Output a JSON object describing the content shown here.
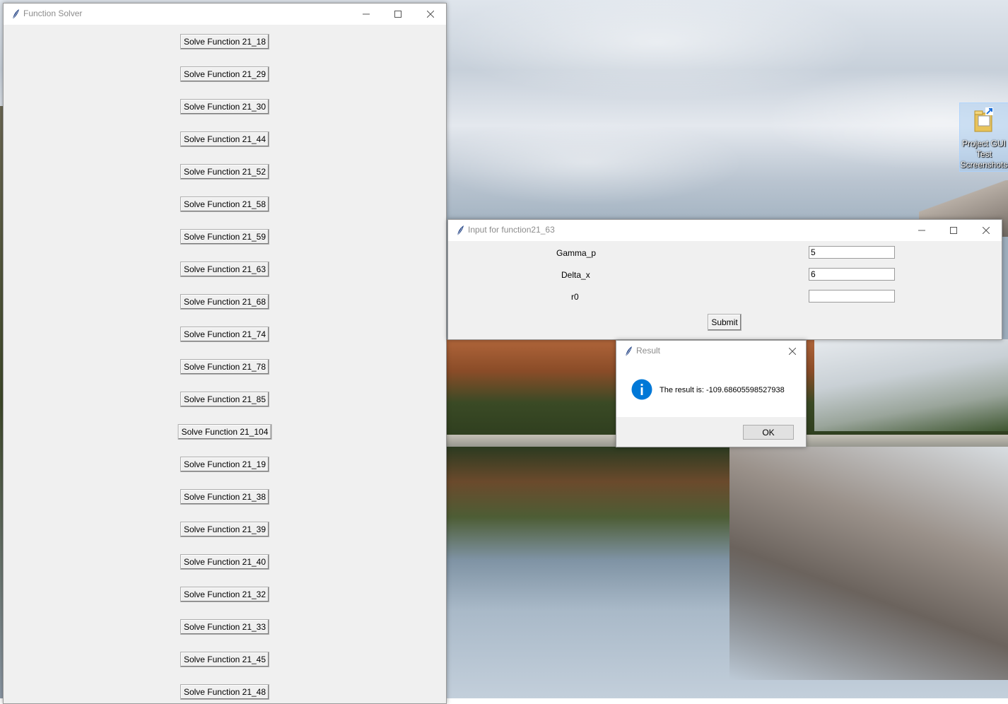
{
  "desktop": {
    "icon_label": "Project GUI Test Screenshots",
    "icon_name": "folder-shortcut-icon"
  },
  "main_window": {
    "title": "Function Solver",
    "buttons": [
      "Solve Function 21_18",
      "Solve Function 21_29",
      "Solve Function 21_30",
      "Solve Function 21_44",
      "Solve Function 21_52",
      "Solve Function 21_58",
      "Solve Function 21_59",
      "Solve Function 21_63",
      "Solve Function 21_68",
      "Solve Function 21_74",
      "Solve Function 21_78",
      "Solve Function 21_85",
      "Solve Function 21_104",
      "Solve Function 21_19",
      "Solve Function 21_38",
      "Solve Function 21_39",
      "Solve Function 21_40",
      "Solve Function 21_32",
      "Solve Function 21_33",
      "Solve Function 21_45",
      "Solve Function 21_48"
    ]
  },
  "input_window": {
    "title": "Input for function21_63",
    "fields": [
      {
        "label": "Gamma_p",
        "value": "5"
      },
      {
        "label": "Delta_x",
        "value": "6"
      },
      {
        "label": "r0",
        "value": ""
      }
    ],
    "submit_label": "Submit"
  },
  "result_dialog": {
    "title": "Result",
    "message": "The result is: -109.68605598527938",
    "ok_label": "OK",
    "icon_name": "info-icon",
    "icon_color": "#0078d7"
  }
}
